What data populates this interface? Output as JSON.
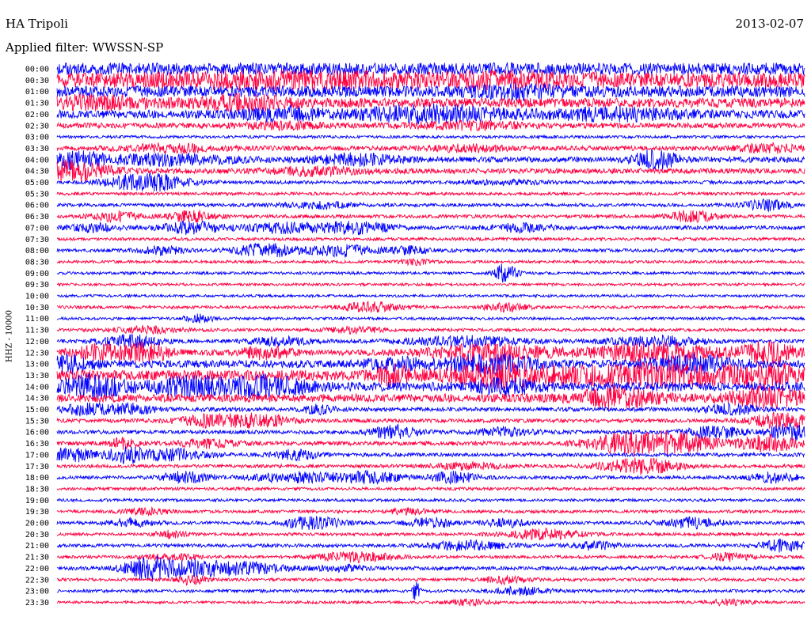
{
  "header": {
    "station": "HA Tripoli",
    "date": "2013-02-07",
    "filter": "Applied filter: WWSSN-SP",
    "channel": "HHZ - 10000"
  },
  "colors": {
    "trace_a": "#0000ff",
    "trace_b": "#ff0040"
  },
  "chart_data": {
    "type": "helicorder",
    "title": "HA Tripoli",
    "ylabel": "HHZ - 10000",
    "grid": false,
    "legend": "none",
    "row_minutes": 30,
    "ticks": [
      "00:00",
      "00:30",
      "01:00",
      "01:30",
      "02:00",
      "02:30",
      "03:00",
      "03:30",
      "04:00",
      "04:30",
      "05:00",
      "05:30",
      "06:00",
      "06:30",
      "07:00",
      "07:30",
      "08:00",
      "08:30",
      "09:00",
      "09:30",
      "10:00",
      "10:30",
      "11:00",
      "11:30",
      "12:00",
      "12:30",
      "13:00",
      "13:30",
      "14:00",
      "14:30",
      "15:00",
      "15:30",
      "16:00",
      "16:30",
      "17:00",
      "17:30",
      "18:00",
      "18:30",
      "19:00",
      "19:30",
      "20:00",
      "20:30",
      "21:00",
      "21:30",
      "22:00",
      "22:30",
      "23:00",
      "23:30"
    ],
    "rows": [
      {
        "t": "00:00",
        "noise": 0.55,
        "bursts": []
      },
      {
        "t": "00:30",
        "noise": 0.7,
        "bursts": [
          [
            0.3,
            0.15,
            0.4
          ],
          [
            0.6,
            0.1,
            0.3
          ]
        ]
      },
      {
        "t": "01:00",
        "noise": 0.5,
        "bursts": [
          [
            0.62,
            0.06,
            0.4
          ]
        ]
      },
      {
        "t": "01:30",
        "noise": 0.4,
        "bursts": [
          [
            0.05,
            0.08,
            0.5
          ],
          [
            0.25,
            0.06,
            0.6
          ]
        ]
      },
      {
        "t": "02:00",
        "noise": 0.35,
        "bursts": [
          [
            0.3,
            0.05,
            0.5
          ],
          [
            0.5,
            0.1,
            0.7
          ],
          [
            0.75,
            0.08,
            0.5
          ]
        ]
      },
      {
        "t": "02:30",
        "noise": 0.18,
        "bursts": [
          [
            0.3,
            0.05,
            0.3
          ],
          [
            0.55,
            0.08,
            0.3
          ]
        ]
      },
      {
        "t": "03:00",
        "noise": 0.05,
        "bursts": []
      },
      {
        "t": "03:30",
        "noise": 0.15,
        "bursts": [
          [
            0.15,
            0.06,
            0.4
          ],
          [
            0.55,
            0.05,
            0.3
          ],
          [
            0.95,
            0.04,
            0.4
          ]
        ]
      },
      {
        "t": "04:00",
        "noise": 0.2,
        "bursts": [
          [
            0.02,
            0.04,
            0.8
          ],
          [
            0.15,
            0.08,
            0.5
          ],
          [
            0.4,
            0.06,
            0.5
          ],
          [
            0.8,
            0.03,
            0.9
          ]
        ]
      },
      {
        "t": "04:30",
        "noise": 0.18,
        "bursts": [
          [
            0.02,
            0.05,
            1.0
          ],
          [
            0.35,
            0.06,
            0.4
          ]
        ]
      },
      {
        "t": "05:00",
        "noise": 0.08,
        "bursts": [
          [
            0.12,
            0.05,
            1.0
          ],
          [
            0.6,
            0.05,
            0.2
          ]
        ]
      },
      {
        "t": "05:30",
        "noise": 0.06,
        "bursts": []
      },
      {
        "t": "06:00",
        "noise": 0.08,
        "bursts": [
          [
            0.35,
            0.05,
            0.3
          ],
          [
            0.95,
            0.03,
            0.5
          ]
        ]
      },
      {
        "t": "06:30",
        "noise": 0.08,
        "bursts": [
          [
            0.08,
            0.03,
            0.5
          ],
          [
            0.18,
            0.03,
            0.6
          ],
          [
            0.85,
            0.03,
            0.6
          ]
        ]
      },
      {
        "t": "07:00",
        "noise": 0.1,
        "bursts": [
          [
            0.05,
            0.03,
            0.4
          ],
          [
            0.18,
            0.04,
            0.6
          ],
          [
            0.3,
            0.05,
            0.5
          ],
          [
            0.4,
            0.05,
            0.6
          ],
          [
            0.62,
            0.04,
            0.4
          ]
        ]
      },
      {
        "t": "07:30",
        "noise": 0.06,
        "bursts": []
      },
      {
        "t": "08:00",
        "noise": 0.08,
        "bursts": [
          [
            0.14,
            0.03,
            0.4
          ],
          [
            0.28,
            0.04,
            0.7
          ],
          [
            0.38,
            0.04,
            0.6
          ],
          [
            0.47,
            0.03,
            0.4
          ]
        ]
      },
      {
        "t": "08:30",
        "noise": 0.05,
        "bursts": [
          [
            0.48,
            0.02,
            0.3
          ]
        ]
      },
      {
        "t": "09:00",
        "noise": 0.05,
        "bursts": [
          [
            0.6,
            0.015,
            1.0
          ]
        ]
      },
      {
        "t": "09:30",
        "noise": 0.04,
        "bursts": []
      },
      {
        "t": "10:00",
        "noise": 0.04,
        "bursts": []
      },
      {
        "t": "10:30",
        "noise": 0.06,
        "bursts": [
          [
            0.42,
            0.04,
            0.5
          ],
          [
            0.6,
            0.03,
            0.4
          ]
        ]
      },
      {
        "t": "11:00",
        "noise": 0.05,
        "bursts": [
          [
            0.19,
            0.02,
            0.4
          ]
        ]
      },
      {
        "t": "11:30",
        "noise": 0.06,
        "bursts": [
          [
            0.12,
            0.05,
            0.3
          ],
          [
            0.4,
            0.04,
            0.3
          ]
        ]
      },
      {
        "t": "12:00",
        "noise": 0.1,
        "bursts": [
          [
            0.1,
            0.04,
            0.6
          ],
          [
            0.3,
            0.04,
            0.4
          ],
          [
            0.55,
            0.08,
            0.5
          ],
          [
            0.8,
            0.06,
            0.5
          ]
        ]
      },
      {
        "t": "12:30",
        "noise": 0.22,
        "bursts": [
          [
            0.06,
            0.04,
            0.7
          ],
          [
            0.12,
            0.03,
            0.9
          ],
          [
            0.28,
            0.03,
            0.6
          ],
          [
            0.58,
            0.08,
            0.8
          ],
          [
            0.8,
            0.08,
            0.9
          ],
          [
            0.95,
            0.04,
            1.0
          ]
        ]
      },
      {
        "t": "13:00",
        "noise": 0.3,
        "bursts": [
          [
            0.02,
            0.03,
            0.8
          ],
          [
            0.45,
            0.04,
            0.5
          ],
          [
            0.58,
            0.06,
            0.9
          ],
          [
            0.85,
            0.06,
            0.8
          ]
        ]
      },
      {
        "t": "13:30",
        "noise": 0.45,
        "bursts": [
          [
            0.45,
            0.02,
            0.9
          ],
          [
            0.6,
            0.08,
            1.0
          ],
          [
            0.8,
            0.1,
            1.0
          ],
          [
            0.95,
            0.05,
            1.0
          ]
        ]
      },
      {
        "t": "14:00",
        "noise": 0.4,
        "bursts": [
          [
            0.05,
            0.04,
            1.0
          ],
          [
            0.18,
            0.05,
            0.8
          ],
          [
            0.28,
            0.05,
            0.9
          ],
          [
            0.6,
            0.04,
            0.6
          ]
        ]
      },
      {
        "t": "14:30",
        "noise": 0.35,
        "bursts": [
          [
            0.75,
            0.05,
            1.0
          ],
          [
            0.95,
            0.05,
            0.9
          ]
        ]
      },
      {
        "t": "15:00",
        "noise": 0.12,
        "bursts": [
          [
            0.04,
            0.03,
            0.6
          ],
          [
            0.1,
            0.03,
            0.5
          ],
          [
            0.35,
            0.02,
            0.4
          ],
          [
            0.9,
            0.04,
            0.5
          ]
        ]
      },
      {
        "t": "15:30",
        "noise": 0.1,
        "bursts": [
          [
            0.2,
            0.04,
            0.6
          ],
          [
            0.27,
            0.04,
            0.7
          ],
          [
            0.97,
            0.04,
            0.8
          ]
        ]
      },
      {
        "t": "16:00",
        "noise": 0.1,
        "bursts": [
          [
            0.45,
            0.03,
            0.7
          ],
          [
            0.6,
            0.04,
            0.4
          ],
          [
            0.88,
            0.04,
            0.6
          ],
          [
            0.98,
            0.03,
            0.8
          ]
        ]
      },
      {
        "t": "16:30",
        "noise": 0.12,
        "bursts": [
          [
            0.09,
            0.02,
            0.5
          ],
          [
            0.2,
            0.04,
            0.4
          ],
          [
            0.76,
            0.05,
            1.0
          ],
          [
            0.83,
            0.05,
            1.0
          ],
          [
            0.95,
            0.04,
            0.8
          ]
        ]
      },
      {
        "t": "17:00",
        "noise": 0.1,
        "bursts": [
          [
            0.02,
            0.03,
            0.7
          ],
          [
            0.09,
            0.02,
            0.8
          ],
          [
            0.15,
            0.05,
            0.6
          ],
          [
            0.32,
            0.03,
            0.5
          ]
        ]
      },
      {
        "t": "17:30",
        "noise": 0.08,
        "bursts": [
          [
            0.55,
            0.05,
            0.3
          ],
          [
            0.78,
            0.05,
            0.8
          ]
        ]
      },
      {
        "t": "18:00",
        "noise": 0.08,
        "bursts": [
          [
            0.17,
            0.03,
            0.6
          ],
          [
            0.32,
            0.06,
            0.5
          ],
          [
            0.42,
            0.04,
            0.6
          ],
          [
            0.53,
            0.03,
            0.6
          ],
          [
            0.96,
            0.03,
            0.5
          ]
        ]
      },
      {
        "t": "18:30",
        "noise": 0.06,
        "bursts": []
      },
      {
        "t": "19:00",
        "noise": 0.05,
        "bursts": []
      },
      {
        "t": "19:30",
        "noise": 0.06,
        "bursts": [
          [
            0.12,
            0.03,
            0.3
          ],
          [
            0.47,
            0.03,
            0.3
          ]
        ]
      },
      {
        "t": "20:00",
        "noise": 0.08,
        "bursts": [
          [
            0.1,
            0.03,
            0.4
          ],
          [
            0.34,
            0.04,
            0.6
          ],
          [
            0.5,
            0.03,
            0.5
          ],
          [
            0.6,
            0.03,
            0.4
          ],
          [
            0.85,
            0.04,
            0.5
          ]
        ]
      },
      {
        "t": "20:30",
        "noise": 0.06,
        "bursts": [
          [
            0.15,
            0.02,
            0.4
          ],
          [
            0.65,
            0.05,
            0.5
          ]
        ]
      },
      {
        "t": "21:00",
        "noise": 0.08,
        "bursts": [
          [
            0.55,
            0.05,
            0.5
          ],
          [
            0.72,
            0.03,
            0.4
          ],
          [
            0.97,
            0.03,
            0.6
          ]
        ]
      },
      {
        "t": "21:30",
        "noise": 0.06,
        "bursts": [
          [
            0.15,
            0.04,
            0.3
          ],
          [
            0.4,
            0.05,
            0.5
          ],
          [
            0.9,
            0.03,
            0.4
          ]
        ]
      },
      {
        "t": "22:00",
        "noise": 0.1,
        "bursts": [
          [
            0.12,
            0.03,
            1.0
          ],
          [
            0.18,
            0.05,
            0.9
          ],
          [
            0.26,
            0.05,
            0.5
          ],
          [
            0.38,
            0.03,
            0.3
          ]
        ]
      },
      {
        "t": "22:30",
        "noise": 0.06,
        "bursts": [
          [
            0.18,
            0.02,
            0.5
          ],
          [
            0.6,
            0.03,
            0.4
          ]
        ]
      },
      {
        "t": "23:00",
        "noise": 0.06,
        "bursts": [
          [
            0.48,
            0.005,
            1.0
          ],
          [
            0.62,
            0.04,
            0.4
          ]
        ]
      },
      {
        "t": "23:30",
        "noise": 0.04,
        "bursts": [
          [
            0.55,
            0.03,
            0.3
          ],
          [
            0.9,
            0.03,
            0.3
          ]
        ]
      }
    ]
  }
}
